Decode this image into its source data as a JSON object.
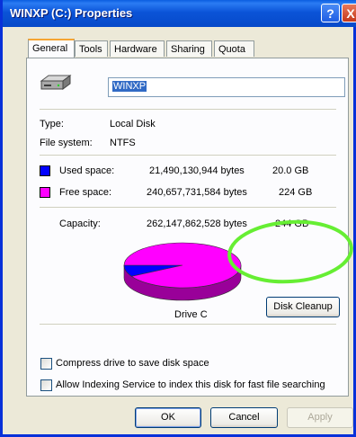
{
  "window": {
    "title": "WINXP (C:) Properties",
    "help_label": "?",
    "close_label": "X"
  },
  "tabs": [
    "General",
    "Tools",
    "Hardware",
    "Sharing",
    "Quota"
  ],
  "general": {
    "drive_name": "WINXP",
    "type_label": "Type:",
    "type_value": "Local Disk",
    "fs_label": "File system:",
    "fs_value": "NTFS",
    "used": {
      "label": "Used space:",
      "bytes": "21,490,130,944 bytes",
      "size": "20.0 GB",
      "color": "#0000ff"
    },
    "free": {
      "label": "Free space:",
      "bytes": "240,657,731,584 bytes",
      "size": "224 GB",
      "color": "#ff00ff"
    },
    "capacity": {
      "label": "Capacity:",
      "bytes": "262,147,862,528 bytes",
      "size": "244 GB"
    },
    "drive_label": "Drive C",
    "cleanup_label": "Disk Cleanup",
    "compress_label": "Compress drive to save disk space",
    "index_label": "Allow Indexing Service to index this disk for fast file searching"
  },
  "chart_data": {
    "type": "pie",
    "categories": [
      "Used space",
      "Free space"
    ],
    "values": [
      21490130944,
      240657731584
    ],
    "colors": [
      "#0000ff",
      "#ff00ff"
    ]
  },
  "buttons": {
    "ok": "OK",
    "cancel": "Cancel",
    "apply": "Apply"
  },
  "highlight_color": "#66ee33"
}
